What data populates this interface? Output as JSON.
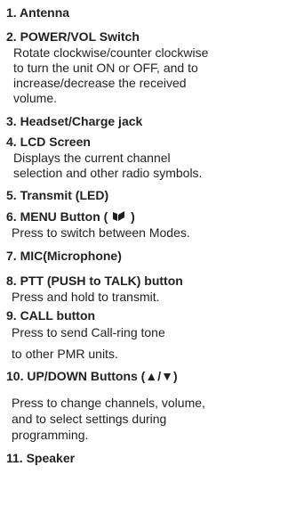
{
  "items": [
    {
      "title": "1. Antenna"
    },
    {
      "title": "2. POWER/VOL Switch",
      "desc": [
        "Rotate clockwise/counter clockwise",
        "to turn the unit ON or OFF, and to",
        "increase/decrease the received",
        "volume."
      ]
    },
    {
      "title": "3. Headset/Charge jack"
    },
    {
      "title": "4. LCD Screen",
      "desc": [
        "Displays the current channel",
        "selection and other radio symbols."
      ]
    },
    {
      "title": "5. Transmit (LED)"
    },
    {
      "title_pre": "6. MENU Button (",
      "icon": "menu-icon",
      "title_post": ")",
      "desc": [
        "Press to switch between Modes."
      ]
    },
    {
      "title": "7. MIC(Microphone)"
    },
    {
      "title": "8. PTT (PUSH to TALK) button",
      "desc": [
        "Press and hold to transmit."
      ]
    },
    {
      "title": "9. CALL button",
      "desc": [
        "Press to send Call-ring tone",
        "to other PMR units."
      ]
    },
    {
      "title_pre": "10. UP/DOWN Buttons (",
      "up_glyph": "▲",
      "slash": "/",
      "down_glyph": "▼",
      "title_post": ")",
      "desc": [
        "Press to change channels, volume,",
        "and to select settings during",
        "programming."
      ]
    },
    {
      "title": "11. Speaker"
    }
  ]
}
